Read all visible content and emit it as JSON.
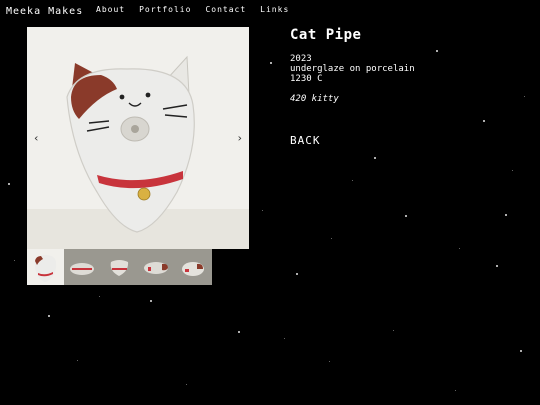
{
  "brand": "Meeka Makes",
  "nav": {
    "about": "About",
    "portfolio": "Portfolio",
    "contact": "Contact",
    "links": "Links"
  },
  "viewer": {
    "prev_icon": "‹",
    "next_icon": "›"
  },
  "piece": {
    "title": "Cat Pipe",
    "year": "2023",
    "material": "underglaze on porcelain",
    "temperature": "1230 C",
    "caption": "420 kitty"
  },
  "back_label": "BACK",
  "colors": {
    "background": "#000000",
    "text": "#ffffff",
    "collar": "#c8343c",
    "patch": "#8a3a2a"
  }
}
